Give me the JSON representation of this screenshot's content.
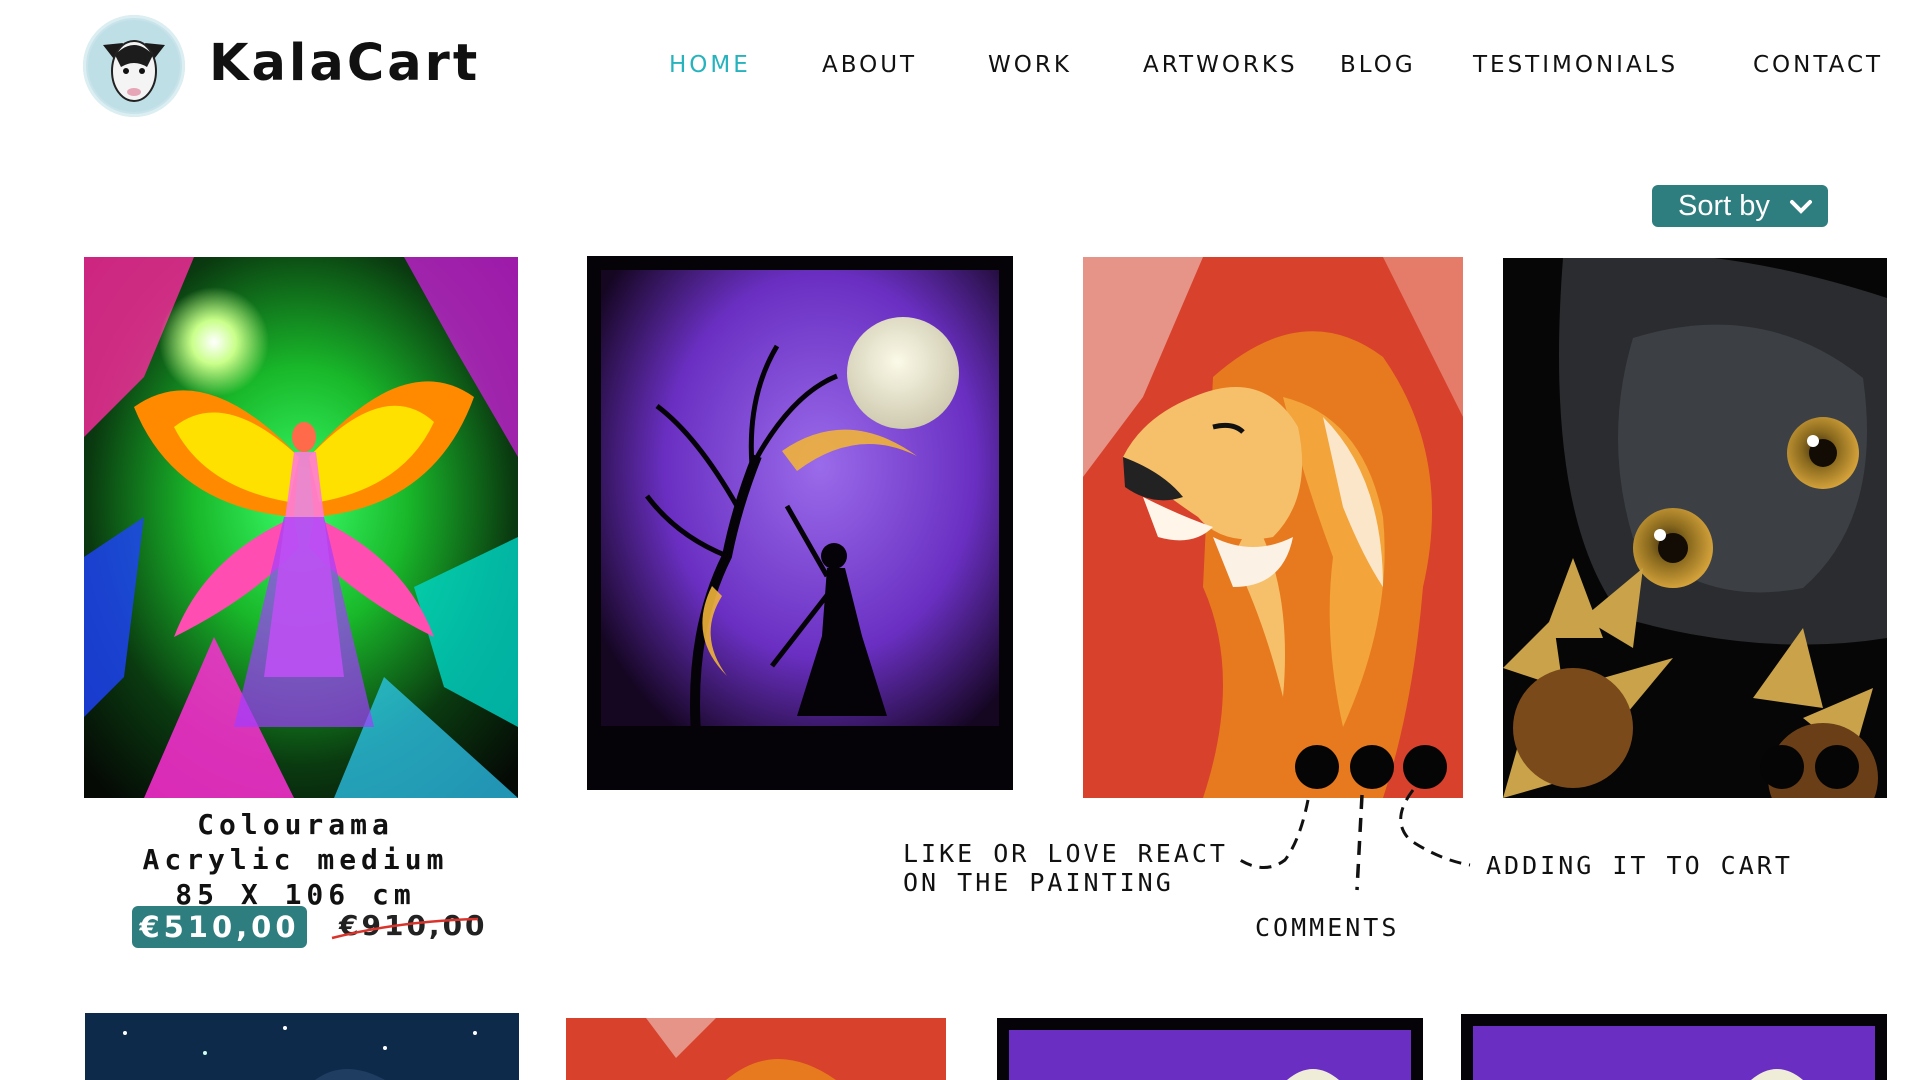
{
  "brand": {
    "name": "KalaCart",
    "logo_icon": "goat-head-icon"
  },
  "nav": [
    {
      "label": "HOME",
      "active": true
    },
    {
      "label": "ABOUT",
      "active": false
    },
    {
      "label": "WORK",
      "active": false
    },
    {
      "label": "ARTWORKS",
      "active": false
    },
    {
      "label": "BLOG",
      "active": false
    },
    {
      "label": "TESTIMONIALS",
      "active": false
    },
    {
      "label": "CONTACT",
      "active": false
    }
  ],
  "sort": {
    "label": "Sort by",
    "icon": "chevron-down-icon"
  },
  "featured": {
    "title": "Colourama",
    "medium": "Acrylic medium",
    "size": "85 X 106 cm",
    "price": "€510,00",
    "original_price": "€910,00"
  },
  "artworks": [
    {
      "subject": "rainbow butterfly angel"
    },
    {
      "subject": "silhouette dancer under full moon"
    },
    {
      "subject": "lion portrait"
    },
    {
      "subject": "black cat with sunflowers"
    },
    {
      "subject": "starry night"
    },
    {
      "subject": "lion portrait"
    },
    {
      "subject": "moon tree"
    },
    {
      "subject": "moon tree"
    }
  ],
  "annotations": {
    "react_line1": "LIKE OR LOVE REACT",
    "react_line2": "ON THE PAINTING",
    "comments": "COMMENTS",
    "cart": "ADDING IT TO CART"
  },
  "colors": {
    "accent": "#26b3be",
    "button": "#2f7e7f",
    "strike": "#d9342b"
  }
}
